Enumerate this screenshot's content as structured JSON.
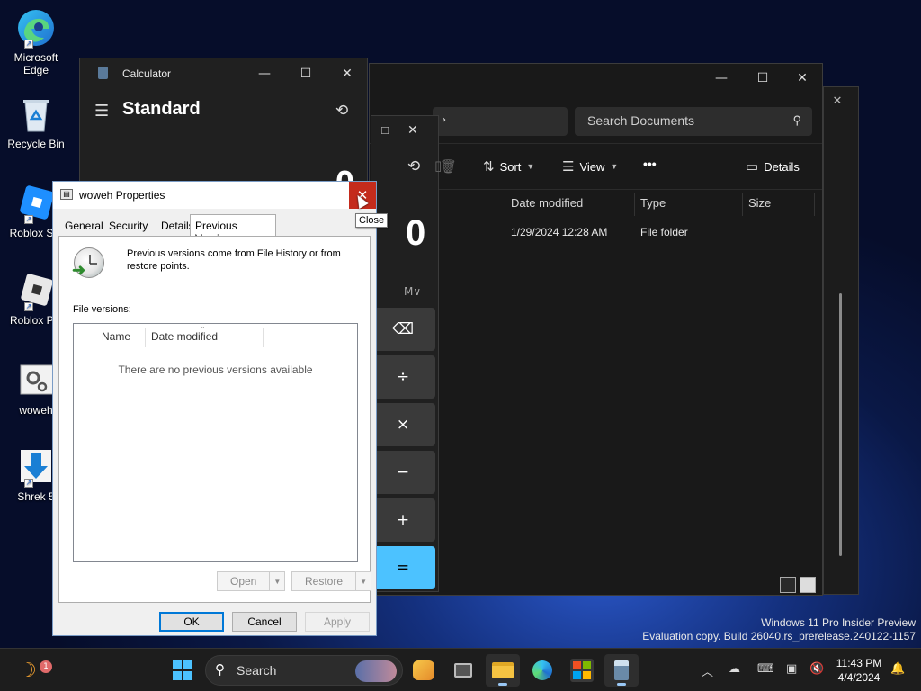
{
  "desktop": {
    "icons": [
      {
        "label": "Microsoft Edge",
        "icon": "edge-icon"
      },
      {
        "label": "Recycle Bin",
        "icon": "recycle-bin-icon"
      },
      {
        "label": "Roblox Stu",
        "icon": "roblox-studio-icon"
      },
      {
        "label": "Roblox Pla",
        "icon": "roblox-player-icon"
      },
      {
        "label": "woweh",
        "icon": "settings-file-icon"
      },
      {
        "label": "Shrek 5",
        "icon": "download-icon"
      }
    ]
  },
  "explorer": {
    "search_placeholder": "Search Documents",
    "commands": {
      "sort": "Sort",
      "view": "View",
      "more": "•••",
      "details": "Details"
    },
    "columns": [
      "Date modified",
      "Type",
      "Size"
    ],
    "rows": [
      {
        "date_modified": "1/29/2024 12:28 AM",
        "type": "File folder"
      }
    ]
  },
  "calculator": {
    "title": "Calculator",
    "mode": "Standard",
    "display": "0",
    "memory_label": "M∨",
    "keys": {
      "backspace": "⌫",
      "divide": "÷",
      "multiply": "×",
      "minus": "−",
      "plus": "+",
      "equals": "="
    }
  },
  "properties": {
    "title": "woweh Properties",
    "close_tooltip": "Close",
    "tabs": [
      "General",
      "Security",
      "Details",
      "Previous Versions"
    ],
    "active_tab": "Previous Versions",
    "description": "Previous versions come from File History or from restore points.",
    "file_versions_label": "File versions:",
    "list_columns": [
      "Name",
      "Date modified"
    ],
    "empty_message": "There are no previous versions available",
    "open_label": "Open",
    "restore_label": "Restore",
    "ok_label": "OK",
    "cancel_label": "Cancel",
    "apply_label": "Apply"
  },
  "watermark": {
    "line1": "Windows 11 Pro Insider Preview",
    "line2": "Evaluation copy. Build 26040.rs_prerelease.240122-1157"
  },
  "taskbar": {
    "search_label": "Search",
    "widget_badge": "1",
    "time": "11:43 PM",
    "date": "4/4/2024",
    "apps": [
      "start-icon",
      "search-icon",
      "copilot-icon",
      "task-view-icon",
      "file-explorer-icon",
      "edge-icon",
      "store-icon",
      "calculator-icon"
    ]
  },
  "colors": {
    "accent": "#4cc2ff",
    "close_red": "#c42b1c",
    "taskbar": "#1d1d1d"
  }
}
